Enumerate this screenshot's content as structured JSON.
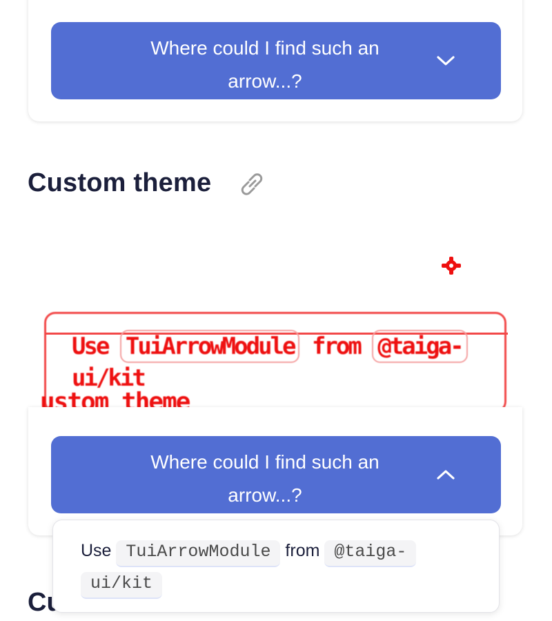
{
  "top_card": {
    "button_label": "Where could I find such an arrow...?",
    "chevron_icon": "chevron-down-icon"
  },
  "section": {
    "heading": "Custom theme",
    "link_icon": "link-icon"
  },
  "glitch_overlay": {
    "text_parts": [
      "Use",
      "TuiArrowModule",
      "from",
      "@taiga-",
      "ui/kit"
    ],
    "heading": "ustom theme",
    "color": "#ee1010"
  },
  "bottom_card": {
    "button_label": "Where could I find such an arrow...?",
    "chevron_icon": "chevron-up-icon"
  },
  "dropdown": {
    "prefix": "Use",
    "module": "TuiArrowModule",
    "connector": "from",
    "package_part1": "@taiga-",
    "package_part2": "ui/kit"
  },
  "next_heading": "Cu",
  "colors": {
    "accent": "#526ed3",
    "heading": "#1b1f3b"
  }
}
